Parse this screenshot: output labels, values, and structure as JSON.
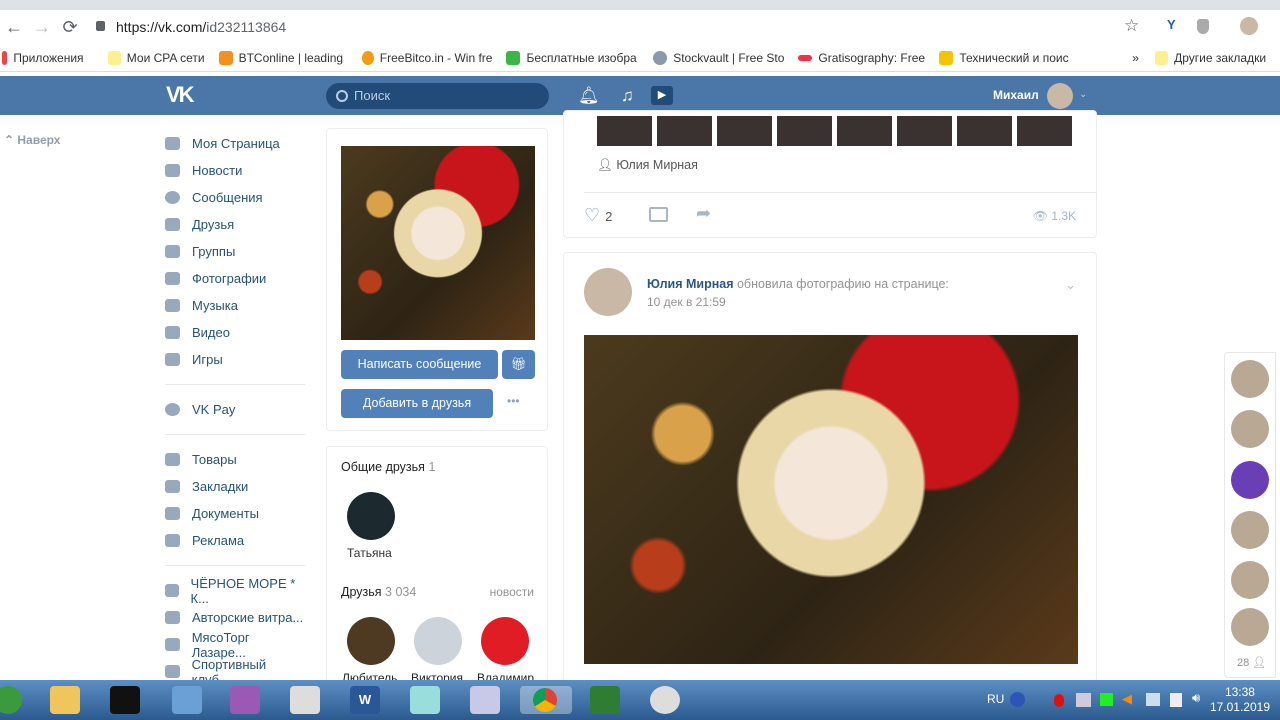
{
  "browser": {
    "url_host": "https://vk.com/",
    "url_path": "id232113864",
    "bookmarks": [
      "Приложения",
      "Мои CPA сети",
      "BTConline | leading",
      "FreeBitco.in - Win fre",
      "Бесплатные изобра",
      "Stockvault | Free Sto",
      "Gratisography: Free",
      "Технический и поис"
    ],
    "more": "»",
    "other": "Другие закладки"
  },
  "header": {
    "logo": "VK",
    "search_placeholder": "Поиск",
    "user_name": "Михаил"
  },
  "scroll_top": "Наверх",
  "nav": {
    "main": [
      "Моя Страница",
      "Новости",
      "Сообщения",
      "Друзья",
      "Группы",
      "Фотографии",
      "Музыка",
      "Видео",
      "Игры"
    ],
    "pay": "VK Pay",
    "extra": [
      "Товары",
      "Закладки",
      "Документы",
      "Реклама"
    ],
    "groups": [
      "ЧЁРНОЕ МОРЕ * К...",
      "Авторские витра...",
      "МясоТорг Лазаре...",
      "Спортивный клуб..."
    ]
  },
  "profile": {
    "send_message": "Написать сообщение",
    "add_friend": "Добавить в друзья",
    "more": "•••",
    "mutual": {
      "title": "Общие друзья",
      "count": "1",
      "friends": [
        "Татьяна"
      ]
    },
    "friends": {
      "title": "Друзья",
      "count": "3 034",
      "link": "новости",
      "items": [
        "Любитель",
        "Виктория",
        "Владимир"
      ]
    }
  },
  "feed": {
    "prev_post": {
      "author": "Юлия Мирная",
      "likes": "2",
      "views": "1.3K"
    },
    "post": {
      "author": "Юлия Мирная",
      "action": "обновила фотографию на странице:",
      "date": "10 дек в 21:59"
    }
  },
  "right_bar": {
    "count": "28"
  },
  "taskbar": {
    "lang": "RU",
    "time": "13:38",
    "date": "17.01.2019"
  }
}
